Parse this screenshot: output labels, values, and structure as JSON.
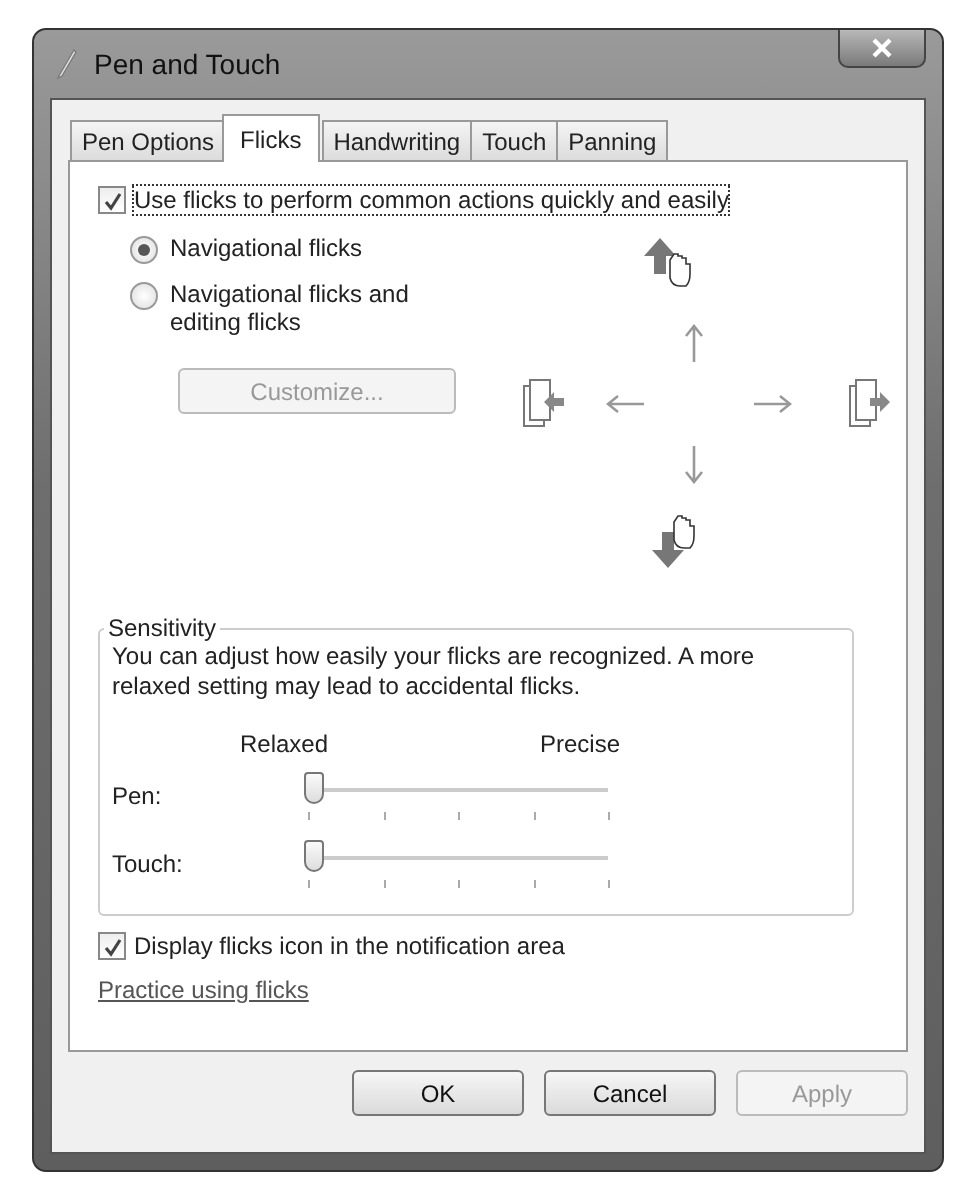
{
  "window": {
    "title": "Pen and Touch"
  },
  "tabs": [
    {
      "label": "Pen Options",
      "selected": false
    },
    {
      "label": "Flicks",
      "selected": true
    },
    {
      "label": "Handwriting",
      "selected": false
    },
    {
      "label": "Touch",
      "selected": false
    },
    {
      "label": "Panning",
      "selected": false
    }
  ],
  "use_flicks": {
    "label": "Use flicks to perform common actions quickly and easily",
    "checked": true
  },
  "flick_modes": [
    {
      "label": "Navigational flicks",
      "selected": true
    },
    {
      "label": "Navigational flicks and editing flicks",
      "selected": false
    }
  ],
  "customize_button": {
    "label": "Customize...",
    "disabled": true
  },
  "sensitivity": {
    "title": "Sensitivity",
    "description": "You can adjust how easily your flicks are recognized. A more relaxed setting may lead to accidental flicks.",
    "scale_left": "Relaxed",
    "scale_right": "Precise",
    "sliders": [
      {
        "label": "Pen:",
        "level": 0
      },
      {
        "label": "Touch:",
        "level": 0
      }
    ]
  },
  "display_icon": {
    "label": "Display flicks icon in the notification area",
    "checked": true
  },
  "practice_link": "Practice using flicks",
  "buttons": [
    {
      "label": "OK",
      "disabled": false
    },
    {
      "label": "Cancel",
      "disabled": false
    },
    {
      "label": "Apply",
      "disabled": true
    }
  ]
}
